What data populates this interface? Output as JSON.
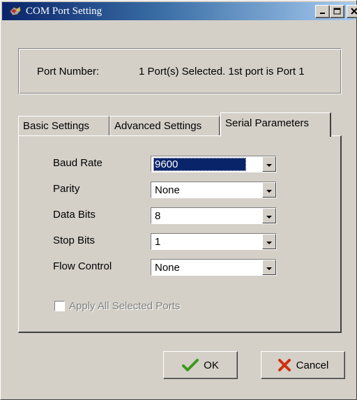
{
  "window": {
    "title": "COM Port Setting",
    "icons": {
      "app": "com-port-icon",
      "minimize": "minimize-icon",
      "maximize": "maximize-icon",
      "close": "close-icon"
    }
  },
  "port": {
    "label": "Port Number:",
    "value": "1 Port(s) Selected. 1st port is Port 1"
  },
  "tabs": [
    {
      "label": "Basic Settings",
      "active": false
    },
    {
      "label": "Advanced Settings",
      "active": false
    },
    {
      "label": "Serial Parameters",
      "active": true
    }
  ],
  "settings": [
    {
      "label": "Baud Rate",
      "value": "9600",
      "focused": true
    },
    {
      "label": "Parity",
      "value": "None",
      "focused": false
    },
    {
      "label": "Data Bits",
      "value": "8",
      "focused": false
    },
    {
      "label": "Stop Bits",
      "value": "1",
      "focused": false
    },
    {
      "label": "Flow Control",
      "value": "None",
      "focused": false
    }
  ],
  "apply_all": {
    "label": "Apply All Selected Ports",
    "checked": false,
    "enabled": false
  },
  "buttons": {
    "ok": {
      "label": "OK",
      "icon": "checkmark-icon",
      "color": "#3a9a1c"
    },
    "cancel": {
      "label": "Cancel",
      "icon": "x-icon",
      "color": "#d03010"
    }
  },
  "colors": {
    "selection": "#0a246a",
    "titlebar_start": "#0a246a",
    "titlebar_end": "#a6caf0",
    "face": "#d4d0c8"
  }
}
